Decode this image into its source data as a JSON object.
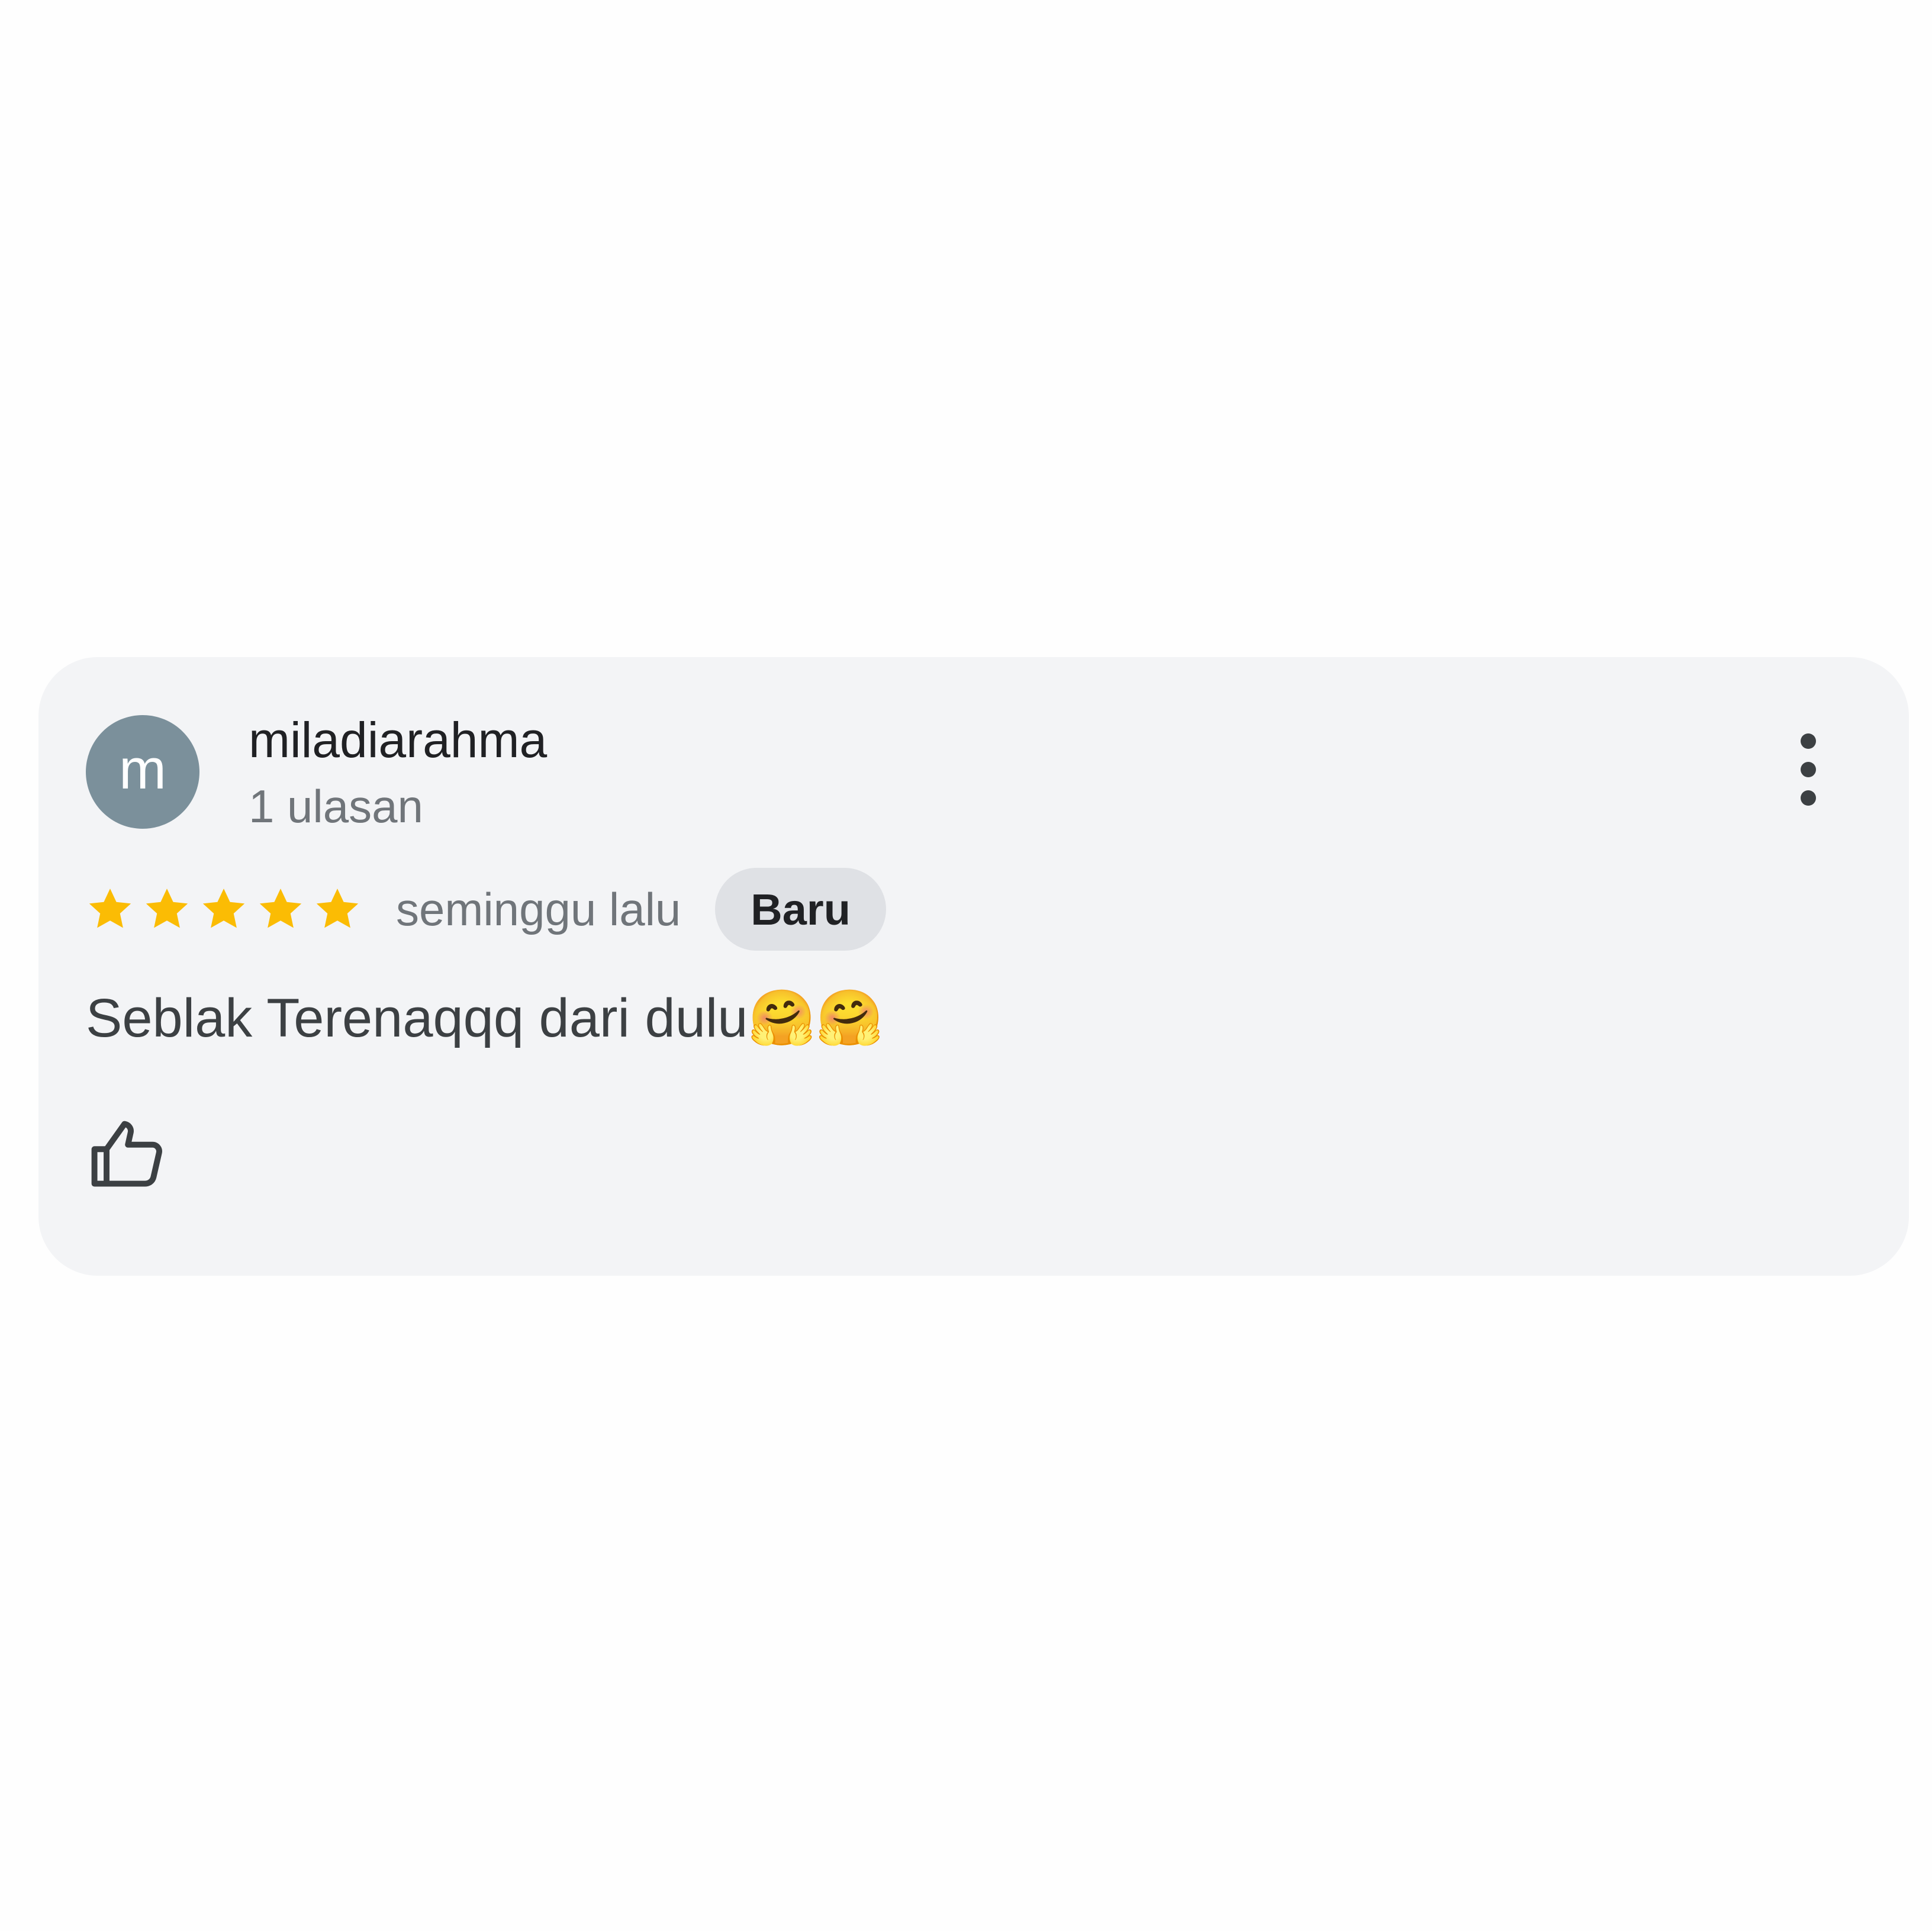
{
  "review": {
    "avatar_initial": "m",
    "author_name": "miladiarahma",
    "review_count": "1 ulasan",
    "rating": 5,
    "rating_max": 5,
    "time": "seminggu lalu",
    "badge": "Baru",
    "text": "Seblak Terenaqqq dari dulu🤗🤗",
    "icons": {
      "more": "more-vert-icon",
      "star": "star-icon",
      "like": "thumb-up-icon"
    },
    "colors": {
      "avatar": "#7b909b",
      "star": "#fbbc04",
      "card_background": "#f3f4f6",
      "badge_background": "#dfe1e5"
    }
  }
}
